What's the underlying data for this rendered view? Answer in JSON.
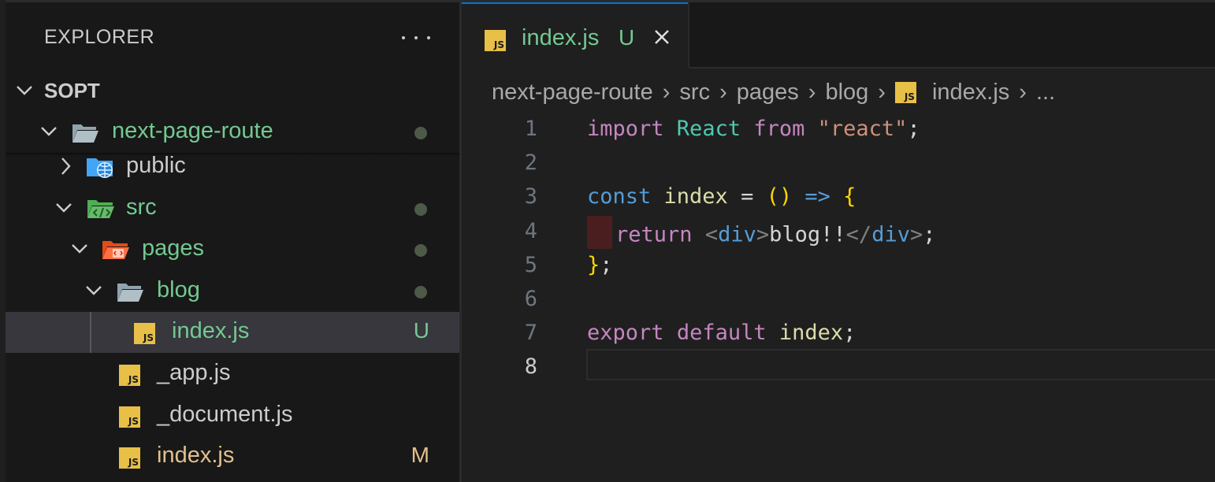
{
  "sidebar": {
    "title": "EXPLORER",
    "workspace": "SOPT",
    "items": [
      {
        "label": "next-page-route",
        "status": "dot"
      },
      {
        "label": "public",
        "status": ""
      },
      {
        "label": "src",
        "status": "dot"
      },
      {
        "label": "pages",
        "status": "dot"
      },
      {
        "label": "blog",
        "status": "dot"
      },
      {
        "label": "index.js",
        "status": "U"
      },
      {
        "label": "_app.js",
        "status": ""
      },
      {
        "label": "_document.js",
        "status": ""
      },
      {
        "label": "index.js",
        "status": "M"
      }
    ]
  },
  "tab": {
    "label": "index.js",
    "status": "U",
    "icon": "JS"
  },
  "breadcrumbs": [
    "next-page-route",
    "src",
    "pages",
    "blog",
    "index.js",
    "..."
  ],
  "line_numbers": [
    "1",
    "2",
    "3",
    "4",
    "5",
    "6",
    "7",
    "8"
  ],
  "code": {
    "l1": {
      "a": "import",
      "b": " React ",
      "c": "from",
      "d": " ",
      "e": "\"react\"",
      "f": ";"
    },
    "l3": {
      "a": "const",
      "b": " index ",
      "c": "=",
      "d": " ",
      "e": "()",
      "f": " ",
      "g": "=>",
      "h": " ",
      "i": "{"
    },
    "l4": {
      "a": "return",
      "b": " ",
      "c": "<",
      "d": "div",
      "e": ">",
      "f": "blog!!",
      "g": "</",
      "h": "div",
      "i": ">",
      "j": ";"
    },
    "l5": {
      "a": "}",
      "b": ";"
    },
    "l7": {
      "a": "export",
      "b": " ",
      "c": "default",
      "d": " index",
      "e": ";"
    }
  },
  "colors": {
    "accent": "#0078d4",
    "untracked": "#73c991",
    "modified": "#e2c08d",
    "js_icon": "#e8bf47"
  }
}
